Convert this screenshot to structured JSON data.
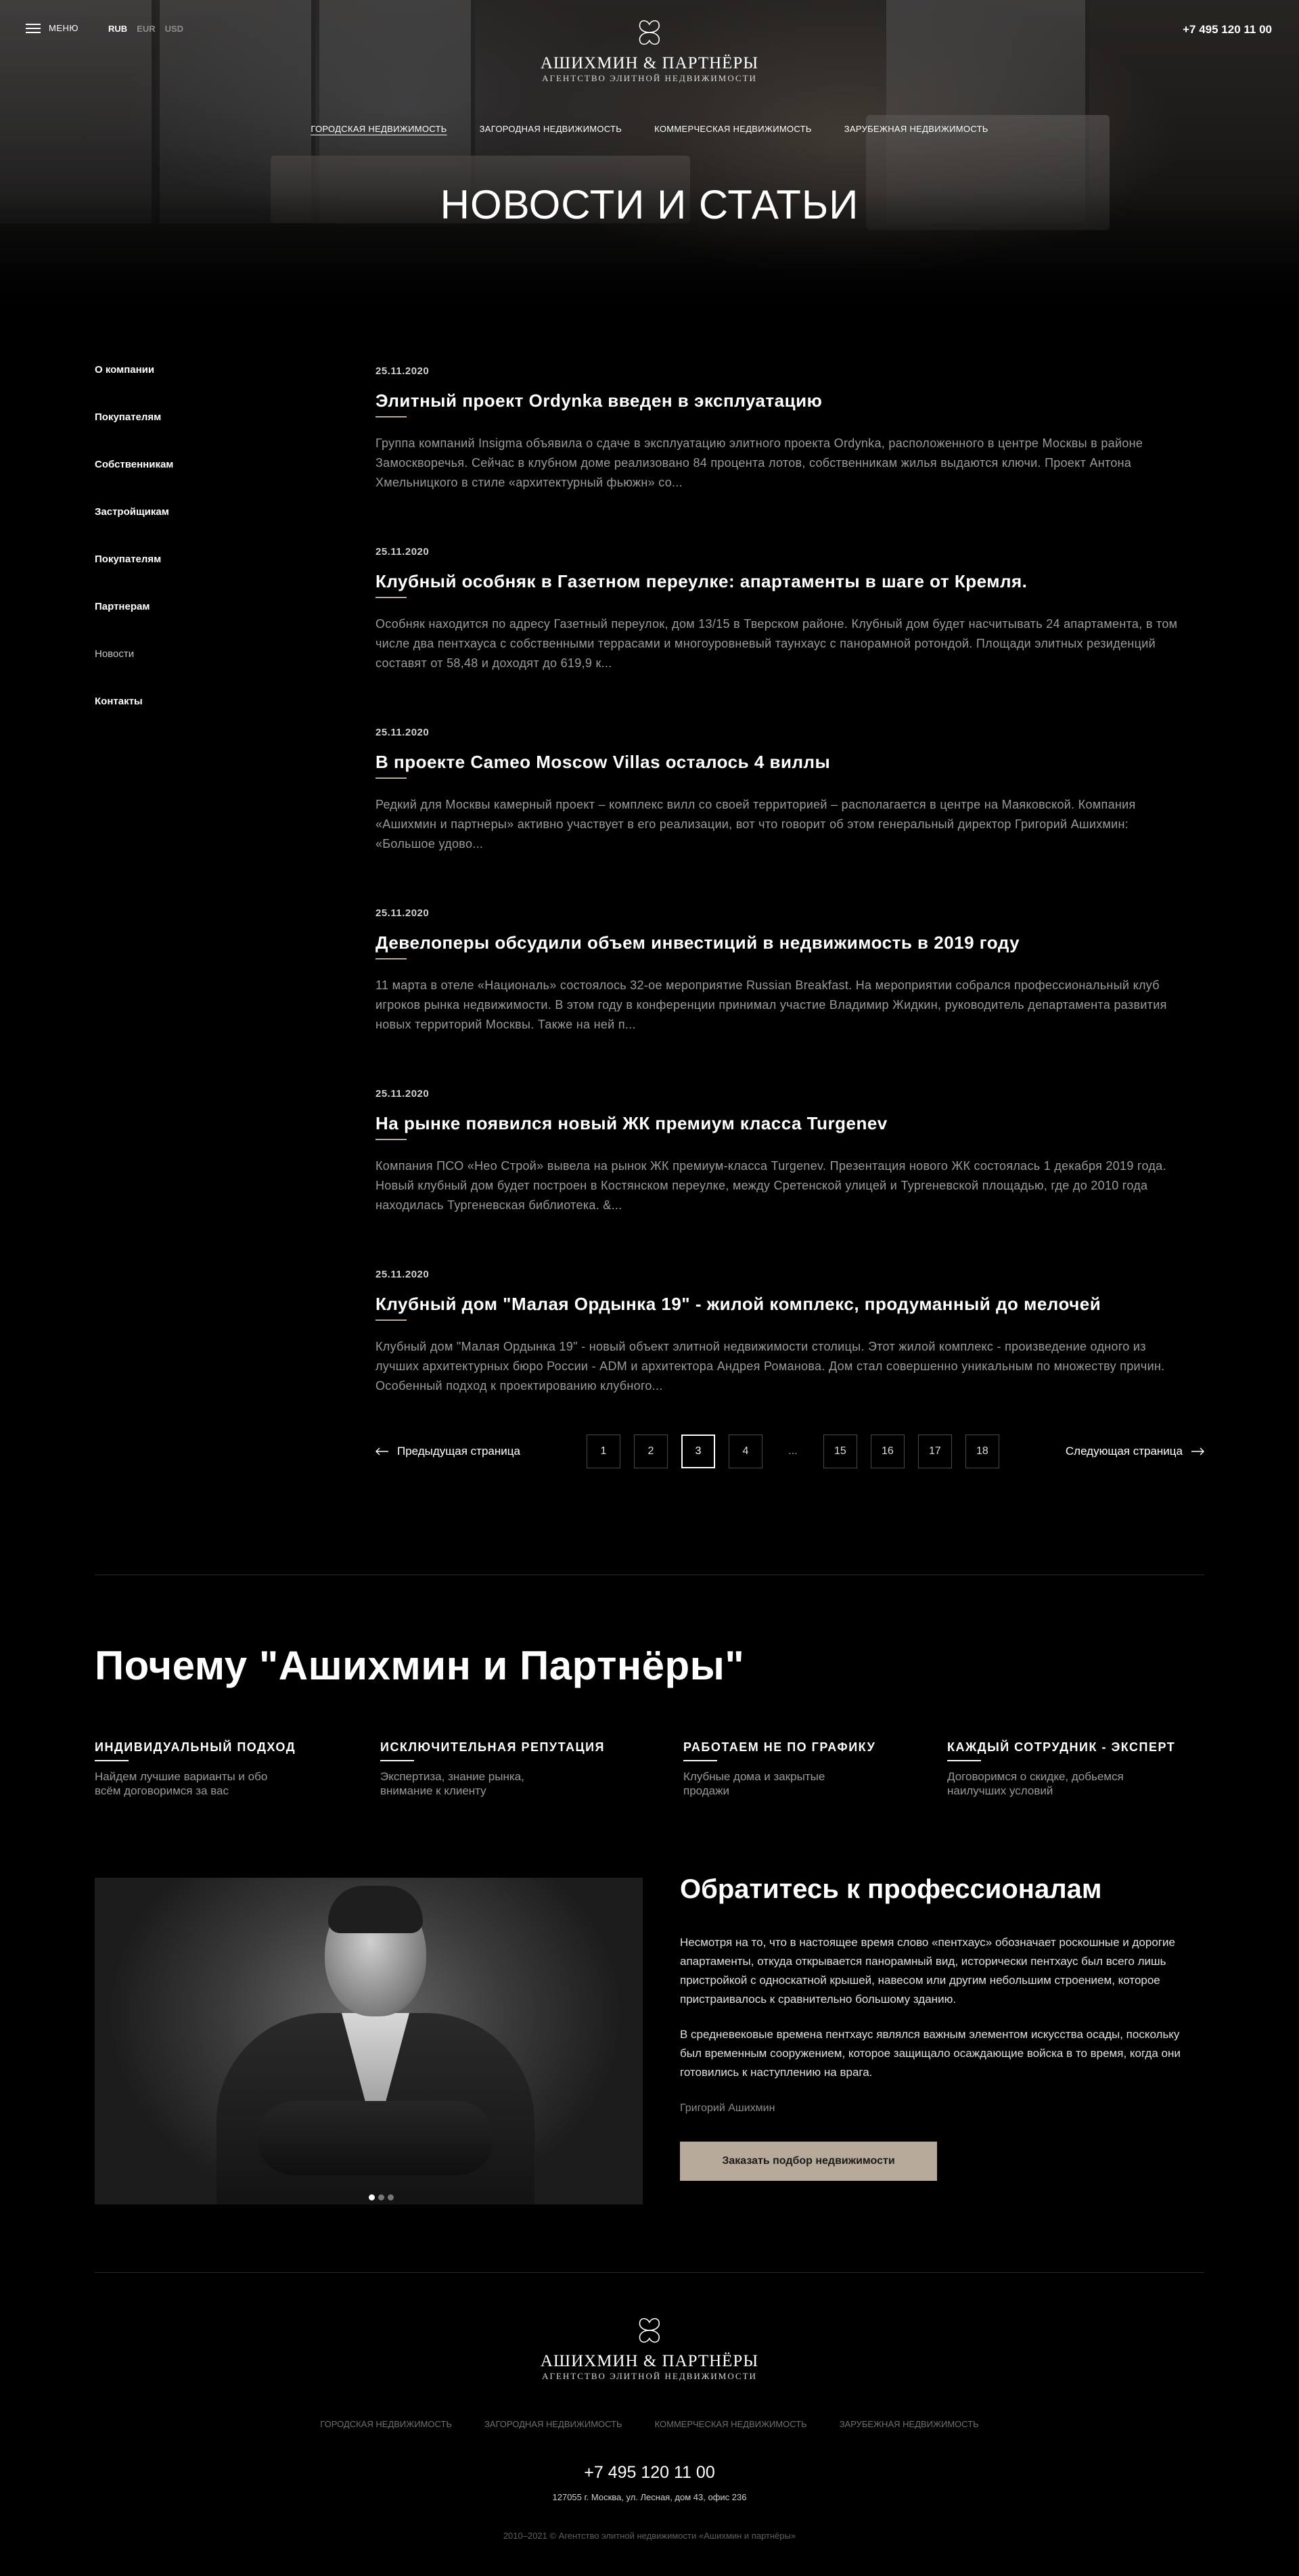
{
  "header": {
    "menu_label": "МЕНЮ",
    "currencies": [
      {
        "label": "RUB",
        "active": true
      },
      {
        "label": "EUR",
        "active": false
      },
      {
        "label": "USD",
        "active": false
      }
    ],
    "logo_name": "АШИХМИН & ПАРТНЁРЫ",
    "logo_sub": "АГЕНТСТВО ЭЛИТНОЙ НЕДВИЖИМОСТИ",
    "phone": "+7 495 120 11 00",
    "nav": [
      {
        "label": "ГОРОДСКАЯ НЕДВИЖИМОСТЬ",
        "active": true
      },
      {
        "label": "ЗАГОРОДНАЯ НЕДВИЖИМОСТЬ",
        "active": false
      },
      {
        "label": "КОММЕРЧЕСКАЯ НЕДВИЖИМОСТЬ",
        "active": false
      },
      {
        "label": "ЗАРУБЕЖНАЯ НЕДВИЖИМОСТЬ",
        "active": false
      }
    ],
    "page_title": "НОВОСТИ И СТАТЬИ"
  },
  "sidebar": {
    "items": [
      {
        "label": "О компании",
        "muted": false
      },
      {
        "label": "Покупателям",
        "muted": false
      },
      {
        "label": "Собственникам",
        "muted": false
      },
      {
        "label": "Застройщикам",
        "muted": false
      },
      {
        "label": "Покупателям",
        "muted": false
      },
      {
        "label": "Партнерам",
        "muted": false
      },
      {
        "label": "Новости",
        "muted": true
      },
      {
        "label": "Контакты",
        "muted": false
      }
    ]
  },
  "articles": [
    {
      "date": "25.11.2020",
      "title": "Элитный проект Ordynka введен в эксплуатацию",
      "excerpt": "Группа компаний Insigma объявила о сдаче в эксплуатацию элитного проекта Ordynka, расположенного в центре Москвы в районе Замоскворечья. Сейчас в клубном доме реализовано 84 процента лотов, собственникам жилья выдаются ключи. Проект Антона Хмельницкого в стиле «архитектурный фьюжн» со..."
    },
    {
      "date": "25.11.2020",
      "title": "Клубный особняк в Газетном переулке: апартаменты в шаге от Кремля.",
      "excerpt": "Особняк находится по адресу Газетный переулок, дом 13/15 в Тверском районе. Клубный дом будет насчитывать 24 апартамента, в том числе два пентхауса с собственными террасами и многоуровневый таунхаус с панорамной ротондой. Площади элитных резиденций составят от 58,48 и доходят до 619,9 к..."
    },
    {
      "date": "25.11.2020",
      "title": "В проекте Cameo Moscow Villas осталось 4 виллы",
      "excerpt": "Редкий для Москвы камерный проект – комплекс вилл со своей территорией – располагается в центре на Маяковской.   Компания «Ашихмин и партнеры» активно участвует в его реализации, вот что говорит об этом генеральный директор Григорий Ашихмин: «Большое удово..."
    },
    {
      "date": "25.11.2020",
      "title": "Девелоперы обсудили объем инвестиций в недвижимость в 2019 году",
      "excerpt": "11 марта в отеле «Националь» состоялось 32-ое мероприятие Russian Breakfast. На мероприятии собрался профессиональный клуб игроков рынка недвижимости. В этом году в конференции принимал участие Владимир Жидкин, руководитель департамента развития новых территорий Москвы. Также на ней п..."
    },
    {
      "date": "25.11.2020",
      "title": "На рынке появился новый ЖК премиум класса Turgenev",
      "excerpt": "Компания ПСО «Нео Строй» вывела на рынок ЖК премиум-класса Turgenev. Презентация нового ЖК состоялась 1 декабря 2019 года. Новый клубный дом будет построен в Костянском переулке, между Сретенской улицей и Тургеневской площадью, где до 2010 года находилась Тургеневская библиотека. &..."
    },
    {
      "date": "25.11.2020",
      "title": "Клубный дом \"Малая Ордынка 19\" - жилой комплекс, продуманный до мелочей",
      "excerpt": "Клубный дом \"Малая Ордынка 19\" - новый объект элитной недвижимости столицы. Этот жилой комплекс - произведение одного из лучших архитектурных бюро России - ADM и архитектора Андрея Романова. Дом стал совершенно уникальным по множеству причин. Особенный подход к проектированию клубного..."
    }
  ],
  "pagination": {
    "prev_label": "Предыдущая страница",
    "next_label": "Следующая страница",
    "pages": [
      "1",
      "2",
      "3",
      "4",
      "...",
      "15",
      "16",
      "17",
      "18"
    ],
    "current": "3"
  },
  "why": {
    "title": "Почему \"Ашихмин и Партнёры\"",
    "features": [
      {
        "title": "ИНДИВИДУАЛЬНЫЙ ПОДХОД",
        "text_1": "Найдем лучшие варианты и обо",
        "text_2": "всём договоримся за вас"
      },
      {
        "title": "ИСКЛЮЧИТЕЛЬНАЯ РЕПУТАЦИЯ",
        "text_1": "Экспертиза, знание рынка,",
        "text_2": "внимание к клиенту"
      },
      {
        "title": "РАБОТАЕМ НЕ ПО ГРАФИКУ",
        "text_1": "Клубные дома и закрытые",
        "text_2": "продажи"
      },
      {
        "title": "КАЖДЫЙ СОТРУДНИК - ЭКСПЕРТ",
        "text_1": "Договоримся о скидке, добьемся",
        "text_2": "наилучших условий"
      }
    ]
  },
  "contact": {
    "title": "Обратитесь к профессионалам",
    "paragraph_1": "Несмотря на то, что в настоящее время слово «пентхаус» обозначает роскошные и дорогие апартаменты, откуда открывается панорамный вид, исторически пентхаус был всего лишь пристройкой с односкатной крышей, навесом или другим небольшим строением, которое пристраивалось к сравнительно большому зданию.",
    "paragraph_2": "В средневековые времена пентхаус являлся важным элементом искусства осады, поскольку был временным сооружением, которое защищало осаждающие войска в то время, когда они готовились к наступлению на врага.",
    "signature": "Григорий Ашихмин",
    "button_label": "Заказать подбор недвижимости",
    "slider_dots": 3,
    "slider_active": 1
  },
  "footer": {
    "logo_name": "АШИХМИН & ПАРТНЁРЫ",
    "logo_sub": "АГЕНТСТВО ЭЛИТНОЙ НЕДВИЖИМОСТИ",
    "nav": [
      "ГОРОДСКАЯ НЕДВИЖИМОСТЬ",
      "ЗАГОРОДНАЯ НЕДВИЖИМОСТЬ",
      "КОММЕРЧЕСКАЯ НЕДВИЖИМОСТЬ",
      "ЗАРУБЕЖНАЯ НЕДВИЖИМОСТЬ"
    ],
    "phone": "+7 495 120 11 00",
    "address": "127055 г. Москва, ул. Лесная, дом 43, офис 236",
    "copyright": "2010–2021 © Агентство элитной недвижимости «Ашихмин и партнёры»"
  },
  "colors": {
    "background": "#000000",
    "accent": "#b7aa9a",
    "muted_text": "#9a9a9a"
  },
  "icons": [
    "menu-icon",
    "logo-flower-icon",
    "arrow-left-icon",
    "arrow-right-icon"
  ]
}
